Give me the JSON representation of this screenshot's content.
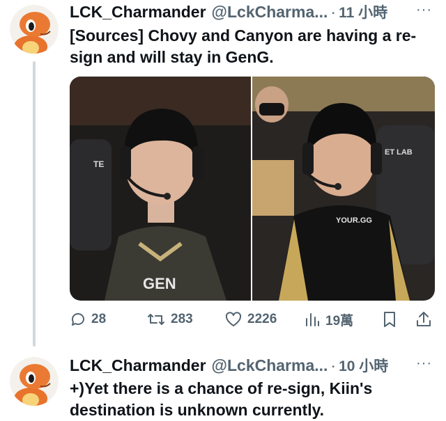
{
  "tweets": [
    {
      "author_name": "LCK_Charmander",
      "handle": "@LckCharma...",
      "separator": "·",
      "time": "11 小時",
      "more_label": "···",
      "text": "[Sources] Chovy and Canyon are having a re-sign and will stay in GenG.",
      "media": {
        "left_photo": {
          "chair_text": "TE",
          "jersey_text": "GEN"
        },
        "right_photo": {
          "chair_text": "ET LAB",
          "jersey_text": "YOUR.GG"
        }
      },
      "actions": {
        "reply": "28",
        "retweet": "283",
        "like": "2226",
        "views": "19萬"
      }
    },
    {
      "author_name": "LCK_Charmander",
      "handle": "@LckCharma...",
      "separator": "·",
      "time": "10 小時",
      "more_label": "···",
      "text": "+)Yet there is a chance of re-sign, Kiin's destination is unknown currently."
    }
  ],
  "colors": {
    "text": "#0f1419",
    "secondary": "#536471",
    "thread_line": "#cfd9de",
    "avatar_orange": "#e8732c"
  },
  "icons": [
    "reply-icon",
    "retweet-icon",
    "like-icon",
    "views-icon",
    "bookmark-icon",
    "share-icon"
  ]
}
